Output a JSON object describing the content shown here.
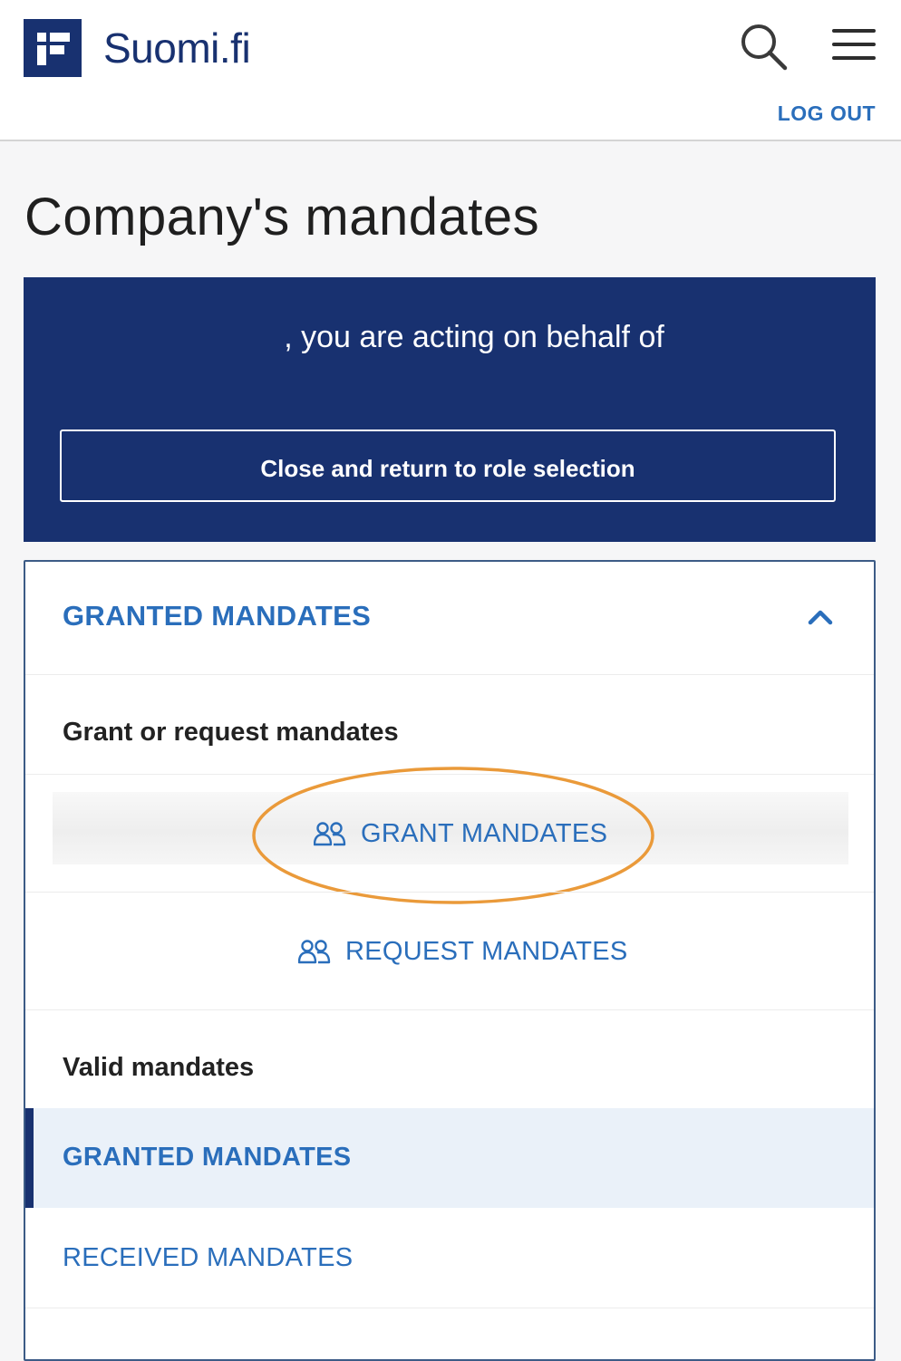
{
  "header": {
    "logo_text": "Suomi.fi",
    "search_icon": "search-icon",
    "menu_icon": "hamburger-menu-icon",
    "logout_label": "LOG OUT"
  },
  "page": {
    "title": "Company's mandates"
  },
  "banner": {
    "acting_text": ", you are acting on behalf of",
    "return_button_label": "Close and return to role selection"
  },
  "panel": {
    "accordion_title": "GRANTED MANDATES",
    "accordion_icon": "chevron-up-icon",
    "grant_request_heading": "Grant or request mandates",
    "grant_button_label": "GRANT MANDATES",
    "request_button_label": "REQUEST MANDATES",
    "action_icon": "users-icon",
    "valid_heading": "Valid mandates",
    "nav_items": [
      {
        "label": "GRANTED MANDATES",
        "active": true
      },
      {
        "label": "RECEIVED MANDATES",
        "active": false
      }
    ]
  },
  "colors": {
    "brand_navy": "#183170",
    "link_blue": "#2a6ebb",
    "highlight_orange": "#ea9a3a",
    "active_row_bg": "#eaf1f9"
  }
}
